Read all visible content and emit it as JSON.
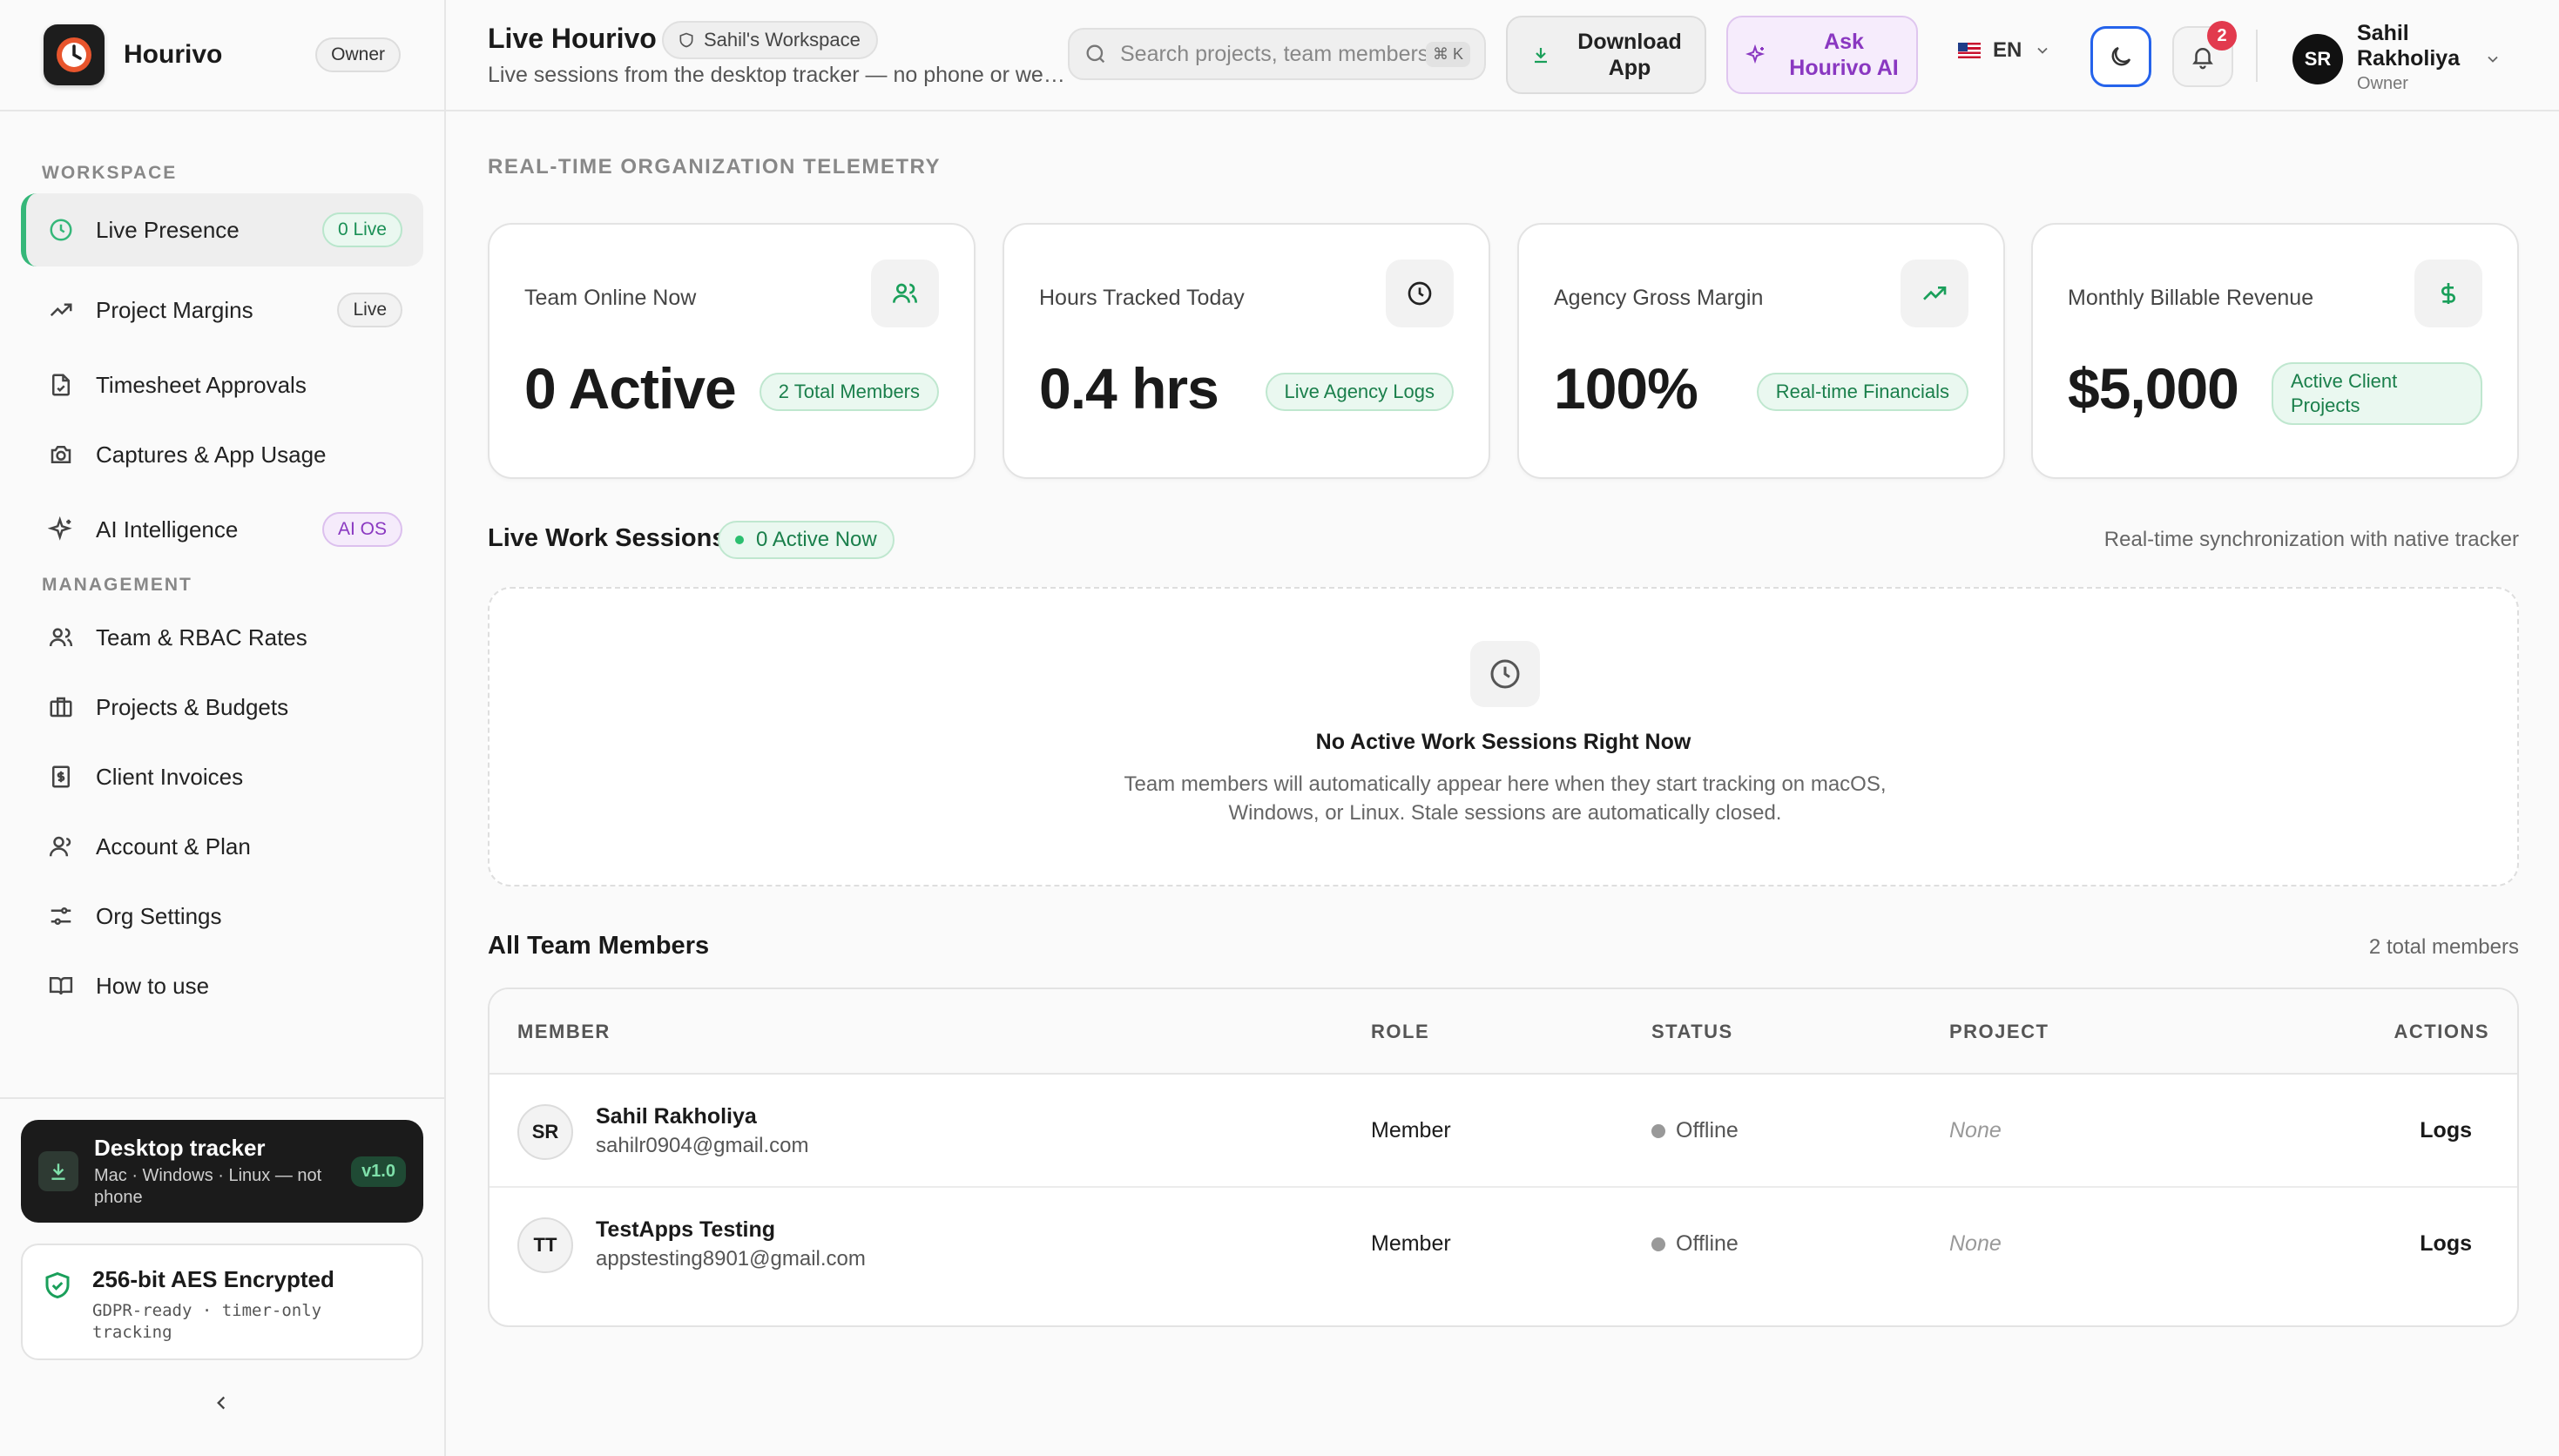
{
  "brand": {
    "name": "Hourivo",
    "role_badge": "Owner"
  },
  "sidebar": {
    "workspace_label": "WORKSPACE",
    "management_label": "MANAGEMENT",
    "workspace_items": [
      {
        "label": "Live Presence",
        "badge": "0 Live",
        "icon": "clock-icon",
        "active": true
      },
      {
        "label": "Project Margins",
        "badge": "Live",
        "icon": "trending-up-icon"
      },
      {
        "label": "Timesheet Approvals",
        "icon": "file-check-icon"
      },
      {
        "label": "Captures & App Usage",
        "icon": "camera-icon"
      },
      {
        "label": "AI Intelligence",
        "badge": "AI OS",
        "icon": "sparkles-icon"
      }
    ],
    "management_items": [
      {
        "label": "Team & RBAC Rates",
        "icon": "users-icon"
      },
      {
        "label": "Projects & Budgets",
        "icon": "briefcase-icon"
      },
      {
        "label": "Client Invoices",
        "icon": "receipt-icon"
      },
      {
        "label": "Account & Plan",
        "icon": "user-icon"
      },
      {
        "label": "Org Settings",
        "icon": "sliders-icon"
      },
      {
        "label": "How to use",
        "icon": "book-icon"
      }
    ],
    "tracker": {
      "title": "Desktop tracker",
      "subtitle": "Mac · Windows · Linux — not phone",
      "version": "v1.0"
    },
    "security": {
      "title": "256-bit AES Encrypted",
      "subtitle": "GDPR-ready · timer-only tracking"
    }
  },
  "header": {
    "title": "Live Hourivo",
    "workspace": "Sahil's Workspace",
    "subtitle": "Live sessions from the desktop tracker — no phone or web timer.",
    "search_placeholder": "Search projects, team members...",
    "search_shortcut": "⌘ K",
    "download_label_1": "Download",
    "download_label_2": "App",
    "ai_label_1": "Ask",
    "ai_label_2": "Hourivo AI",
    "lang": "EN",
    "notifications_count": "2",
    "user": {
      "initials": "SR",
      "name": "Sahil Rakholiya",
      "role": "Owner"
    }
  },
  "main": {
    "telemetry_label": "REAL-TIME ORGANIZATION TELEMETRY",
    "stats": [
      {
        "title": "Team Online Now",
        "value": "0 Active",
        "badge": "2 Total Members",
        "icon": "users-icon",
        "color": "#1a9f5a"
      },
      {
        "title": "Hours Tracked Today",
        "value": "0.4 hrs",
        "badge": "Live Agency Logs",
        "icon": "clock-icon",
        "color": "#222222"
      },
      {
        "title": "Agency Gross Margin",
        "value": "100%",
        "badge": "Real-time Financials",
        "icon": "trending-up-icon",
        "color": "#1a9f5a"
      },
      {
        "title": "Monthly Billable Revenue",
        "value": "$5,000",
        "badge": "Active Client Projects",
        "icon": "dollar-icon",
        "color": "#1a9f5a"
      }
    ],
    "sessions": {
      "title": "Live Work Sessions",
      "active_chip": "0 Active Now",
      "sync_note": "Real-time synchronization with native tracker",
      "empty_title": "No Active Work Sessions Right Now",
      "empty_desc": "Team members will automatically appear here when they start tracking on macOS, Windows, or Linux. Stale sessions are automatically closed."
    },
    "members": {
      "title": "All Team Members",
      "count": "2 total members",
      "columns": [
        "MEMBER",
        "ROLE",
        "STATUS",
        "PROJECT",
        "ACTIONS"
      ],
      "rows": [
        {
          "initials": "SR",
          "name": "Sahil Rakholiya",
          "email": "sahilr0904@gmail.com",
          "role": "Member",
          "status": "Offline",
          "project": "None",
          "action": "Logs"
        },
        {
          "initials": "TT",
          "name": "TestApps Testing",
          "email": "appstesting8901@gmail.com",
          "role": "Member",
          "status": "Offline",
          "project": "None",
          "action": "Logs"
        }
      ]
    }
  },
  "colors": {
    "accent_green": "#35b779",
    "ai_purple": "#8a38c1",
    "alert_red": "#e23a4e",
    "focus_blue": "#2563eb"
  }
}
